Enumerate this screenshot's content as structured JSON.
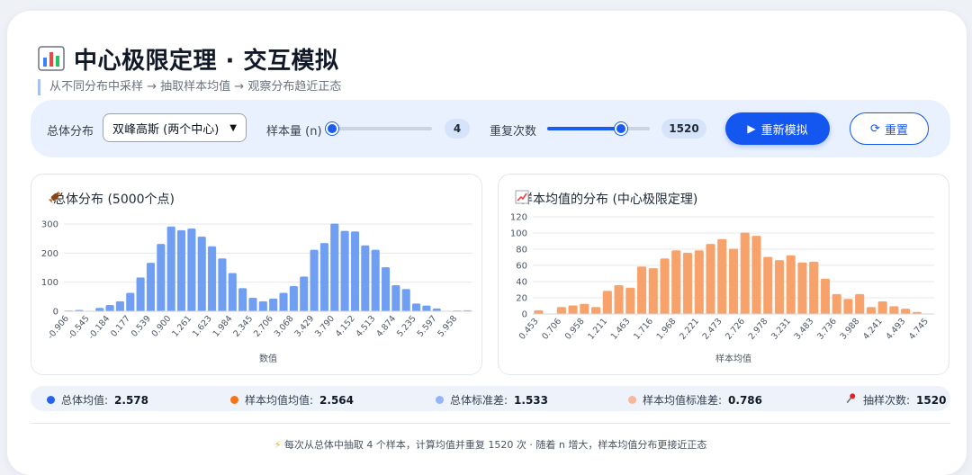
{
  "header": {
    "title": "中心极限定理 · 交互模拟",
    "subtitle": "从不同分布中采样 → 抽取样本均值 → 观察分布趋近正态",
    "icon": "bar-chart-icon"
  },
  "controls": {
    "population_label": "总体分布",
    "population_value": "双峰高斯 (两个中心)",
    "sample_size_label": "样本量 (n)",
    "sample_size_value": "4",
    "sample_size_fraction": 0.03,
    "repeat_label": "重复次数",
    "repeat_value": "1520",
    "repeat_fraction": 0.72,
    "resimulate_label": "重新模拟",
    "reset_label": "重置",
    "accent_color": "#1356f0"
  },
  "stats": {
    "pop_mean_label": "总体均值:",
    "pop_mean_value": "2.578",
    "sample_mean_label": "样本均值均值:",
    "sample_mean_value": "2.564",
    "pop_std_label": "总体标准差:",
    "pop_std_value": "1.533",
    "sample_std_label": "样本均值标准差:",
    "sample_std_value": "0.786",
    "draws_label": "抽样次数:",
    "draws_value": "1520"
  },
  "footer": {
    "text": "每次从总体中抽取 4 个样本，计算均值并重复 1520 次 · 随着 n 增大，样本均值分布更接近正态"
  },
  "chart_data": [
    {
      "type": "bar",
      "title": "总体分布 (5000个点)",
      "title_icon": "candy-icon",
      "xlabel": "数值",
      "ylabel": "",
      "ylim": [
        0,
        300
      ],
      "yticks": [
        0,
        100,
        200,
        300
      ],
      "color": "#6f9ef3",
      "categories": [
        "-0.906",
        "-0.725",
        "-0.545",
        "-0.364",
        "-0.184",
        "-0.003",
        "0.177",
        "0.358",
        "0.539",
        "0.719",
        "0.900",
        "1.081",
        "1.261",
        "1.442",
        "1.623",
        "1.803",
        "1.984",
        "2.164",
        "2.345",
        "2.525",
        "2.706",
        "2.887",
        "3.068",
        "3.248",
        "3.429",
        "3.609",
        "3.790",
        "3.970",
        "4.152",
        "4.332",
        "4.513",
        "4.693",
        "4.874",
        "5.054",
        "5.235",
        "5.415",
        "5.597",
        "5.777",
        "5.958",
        "6.138"
      ],
      "tick_labels": [
        "-0.906",
        "-0.545",
        "-0.184",
        "0.177",
        "0.539",
        "0.900",
        "1.261",
        "1.623",
        "1.984",
        "2.345",
        "2.706",
        "3.068",
        "3.429",
        "3.790",
        "4.152",
        "4.513",
        "4.874",
        "5.235",
        "5.597",
        "5.958"
      ],
      "values": [
        1,
        3,
        0,
        10,
        20,
        33,
        62,
        115,
        165,
        230,
        290,
        277,
        283,
        255,
        222,
        180,
        130,
        78,
        45,
        33,
        42,
        62,
        85,
        118,
        210,
        233,
        300,
        275,
        273,
        225,
        210,
        150,
        88,
        75,
        25,
        18,
        8,
        0,
        1,
        2
      ]
    },
    {
      "type": "bar",
      "title": "样本均值的分布 (中心极限定理)",
      "title_icon": "trend-chart-icon",
      "xlabel": "样本均值",
      "ylabel": "",
      "ylim": [
        0,
        120
      ],
      "yticks": [
        0,
        20,
        40,
        60,
        80,
        100,
        120
      ],
      "color": "#f7a26b",
      "categories": [
        "0.453",
        "0.579",
        "0.706",
        "0.832",
        "0.958",
        "1.084",
        "1.211",
        "1.337",
        "1.463",
        "1.590",
        "1.716",
        "1.842",
        "1.968",
        "2.095",
        "2.221",
        "2.347",
        "2.473",
        "2.600",
        "2.726",
        "2.852",
        "2.978",
        "3.104",
        "3.231",
        "3.357",
        "3.483",
        "3.609",
        "3.736",
        "3.862",
        "3.988",
        "4.114",
        "4.241",
        "4.367",
        "4.493",
        "4.619",
        "4.745"
      ],
      "tick_labels": [
        "0.453",
        "0.706",
        "0.958",
        "1.211",
        "1.463",
        "1.716",
        "1.968",
        "2.221",
        "2.473",
        "2.726",
        "2.978",
        "3.231",
        "3.483",
        "3.736",
        "3.988",
        "4.241",
        "4.493",
        "4.745"
      ],
      "values": [
        4,
        0,
        8,
        10,
        12,
        8,
        28,
        35,
        32,
        58,
        56,
        68,
        78,
        75,
        78,
        86,
        92,
        80,
        100,
        96,
        70,
        66,
        72,
        63,
        64,
        43,
        24,
        18,
        24,
        8,
        15,
        9,
        6,
        2,
        0
      ]
    }
  ]
}
